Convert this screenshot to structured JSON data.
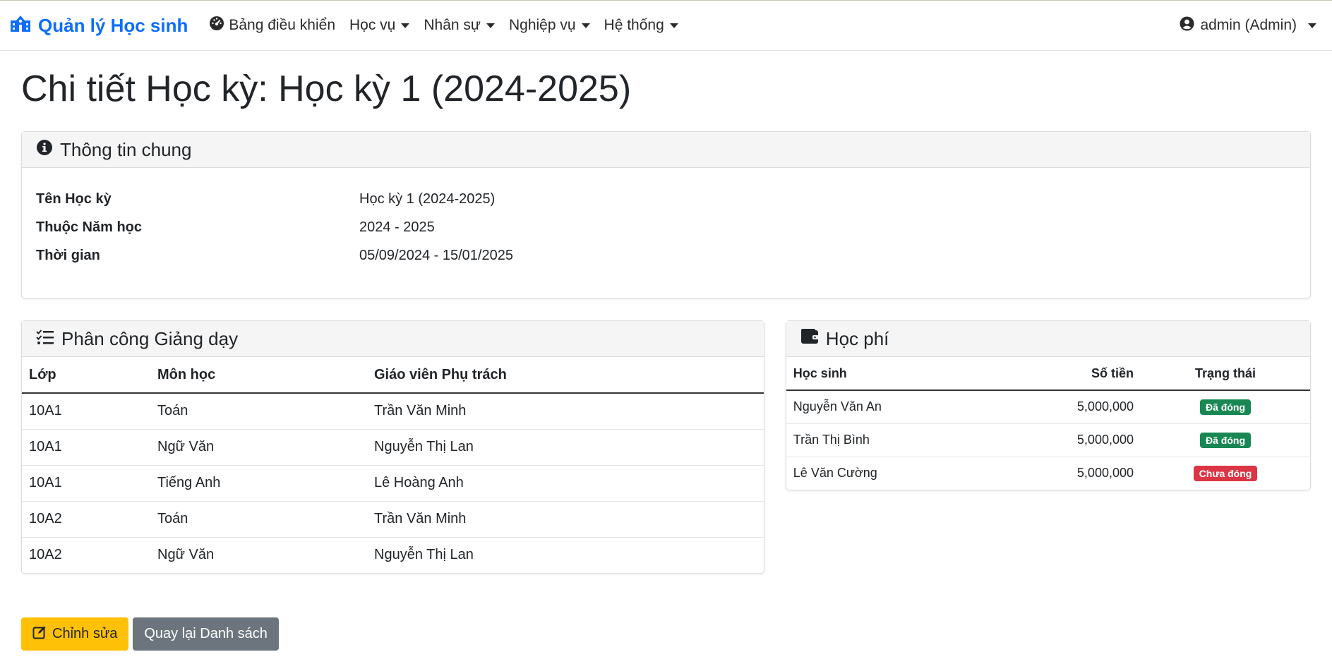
{
  "brand": {
    "title": "Quản lý Học sinh",
    "color": "#0d6efd"
  },
  "nav": {
    "items": [
      {
        "label": "Bảng điều khiển",
        "icon": "dashboard-icon",
        "has_dropdown": false
      },
      {
        "label": "Học vụ",
        "has_dropdown": true
      },
      {
        "label": "Nhân sự",
        "has_dropdown": true
      },
      {
        "label": "Nghiệp vụ",
        "has_dropdown": true
      },
      {
        "label": "Hệ thống",
        "has_dropdown": true
      }
    ],
    "user": {
      "label": "admin (Admin)",
      "icon": "user-circle-icon"
    }
  },
  "page": {
    "title": "Chi tiết Học kỳ: Học kỳ 1 (2024-2025)"
  },
  "general_info": {
    "header": "Thông tin chung",
    "icon": "info-circle-icon",
    "rows": [
      {
        "label": "Tên Học kỳ",
        "value": "Học kỳ 1 (2024-2025)"
      },
      {
        "label": "Thuộc Năm học",
        "value": "2024 - 2025"
      },
      {
        "label": "Thời gian",
        "value": "05/09/2024 - 15/01/2025"
      }
    ]
  },
  "assignments": {
    "header": "Phân công Giảng dạy",
    "icon": "list-check-icon",
    "columns": [
      "Lớp",
      "Môn học",
      "Giáo viên Phụ trách"
    ],
    "rows": [
      [
        "10A1",
        "Toán",
        "Trần Văn Minh"
      ],
      [
        "10A1",
        "Ngữ Văn",
        "Nguyễn Thị Lan"
      ],
      [
        "10A1",
        "Tiếng Anh",
        "Lê Hoàng Anh"
      ],
      [
        "10A2",
        "Toán",
        "Trần Văn Minh"
      ],
      [
        "10A2",
        "Ngữ Văn",
        "Nguyễn Thị Lan"
      ]
    ]
  },
  "fees": {
    "header": "Học phí",
    "icon": "wallet-icon",
    "columns": [
      "Học sinh",
      "Số tiền",
      "Trạng thái"
    ],
    "rows": [
      {
        "student": "Nguyễn Văn An",
        "amount": "5,000,000",
        "status": "Đã đóng",
        "status_color": "#198754"
      },
      {
        "student": "Trần Thị Bình",
        "amount": "5,000,000",
        "status": "Đã đóng",
        "status_color": "#198754"
      },
      {
        "student": "Lê Văn Cường",
        "amount": "5,000,000",
        "status": "Chưa đóng",
        "status_color": "#dc3545"
      }
    ]
  },
  "actions": {
    "edit_label": "Chỉnh sửa",
    "edit_icon": "edit-icon",
    "back_label": "Quay lại Danh sách"
  }
}
